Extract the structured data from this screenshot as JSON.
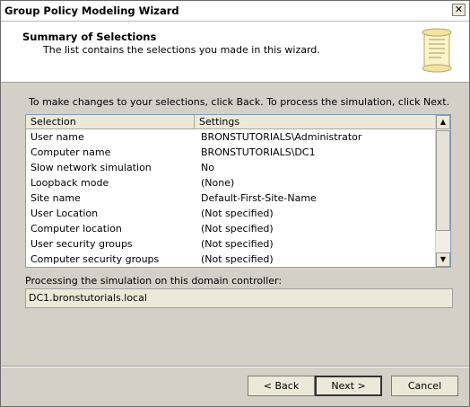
{
  "window": {
    "title": "Group Policy Modeling Wizard",
    "close_glyph": "✕"
  },
  "header": {
    "title": "Summary of Selections",
    "subtitle": "The list contains the selections you made in this wizard."
  },
  "instructions": "To make changes to your selections, click Back. To process the simulation, click Next.",
  "list": {
    "columns": [
      "Selection",
      "Settings"
    ],
    "rows": [
      [
        "User name",
        "BRONSTUTORIALS\\Administrator"
      ],
      [
        "Computer name",
        "BRONSTUTORIALS\\DC1"
      ],
      [
        "Slow network simulation",
        "No"
      ],
      [
        "Loopback mode",
        "(None)"
      ],
      [
        "Site name",
        "Default-First-Site-Name"
      ],
      [
        "User Location",
        "(Not specified)"
      ],
      [
        "Computer location",
        "(Not specified)"
      ],
      [
        "User security groups",
        "(Not specified)"
      ],
      [
        "Computer security groups",
        "(Not specified)"
      ]
    ]
  },
  "processing": {
    "label": "Processing the simulation on this domain controller:",
    "value": "DC1.bronstutorials.local"
  },
  "buttons": {
    "back": "< Back",
    "next": "Next >",
    "cancel": "Cancel"
  },
  "icons": {
    "header_icon": "scroll-icon",
    "scroll_up": "scroll-up-arrow-icon",
    "scroll_down": "scroll-down-arrow-icon"
  }
}
